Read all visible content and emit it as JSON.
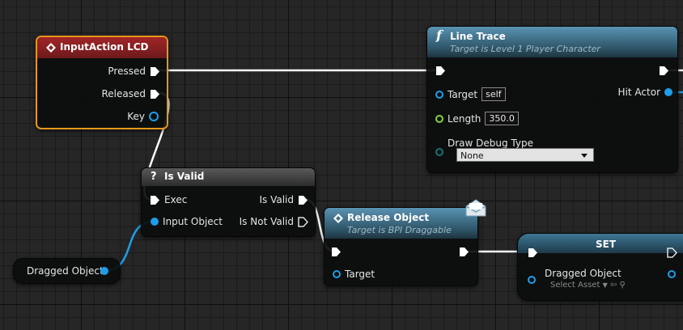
{
  "colors": {
    "exec_wire": "#ffffff",
    "object_wire": "#1d9ee8",
    "event_header": "#8f1f22",
    "function_header": "#4a7d99",
    "selection": "#e6961b",
    "pure_header": "#444444",
    "set_header": "#3e6f86"
  },
  "input_action": {
    "title": "InputAction LCD",
    "icon": "event-diamond-icon",
    "pins": {
      "pressed": "Pressed",
      "released": "Released",
      "key": "Key"
    }
  },
  "line_trace": {
    "title": "Line Trace",
    "subtitle": "Target is Level 1 Player Character",
    "icon": "function-icon",
    "target_label": "Target",
    "target_value": "self",
    "length_label": "Length",
    "length_value": "350.0",
    "debug_label": "Draw Debug Type",
    "debug_value": "None",
    "hit_actor_label": "Hit Actor"
  },
  "is_valid": {
    "title": "Is Valid",
    "icon": "question-icon",
    "exec_label": "Exec",
    "input_label": "Input Object",
    "valid_label": "Is Valid",
    "not_valid_label": "Is Not Valid"
  },
  "release_object": {
    "title": "Release Object",
    "subtitle": "Target is BPI Draggable",
    "icon": "message-envelope-icon",
    "target_label": "Target"
  },
  "set_node": {
    "title": "SET",
    "var_label": "Dragged Object",
    "select_asset": "Select Asset"
  },
  "dragged_object_getter": {
    "label": "Dragged Object"
  }
}
